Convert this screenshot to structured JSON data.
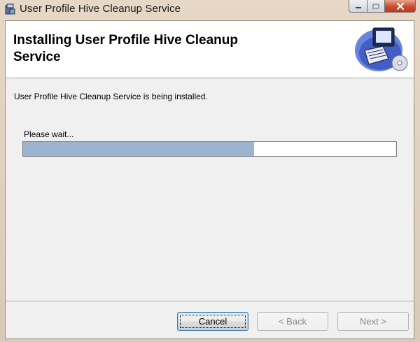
{
  "window": {
    "title": "User Profile Hive Cleanup Service"
  },
  "banner": {
    "title": "Installing User Profile Hive Cleanup Service"
  },
  "main": {
    "status_text": "User Profile Hive Cleanup Service is being installed.",
    "wait_text": "Please wait...",
    "progress_fraction": 0.62
  },
  "buttons": {
    "cancel": "Cancel",
    "back": "< Back",
    "next": "Next >"
  },
  "colors": {
    "progress_fill": "#9bb4cf",
    "close_button": "#c84f30"
  },
  "icons": [
    "installer-icon",
    "minimize-icon",
    "maximize-icon",
    "close-icon",
    "computer-disc-banner-icon"
  ]
}
